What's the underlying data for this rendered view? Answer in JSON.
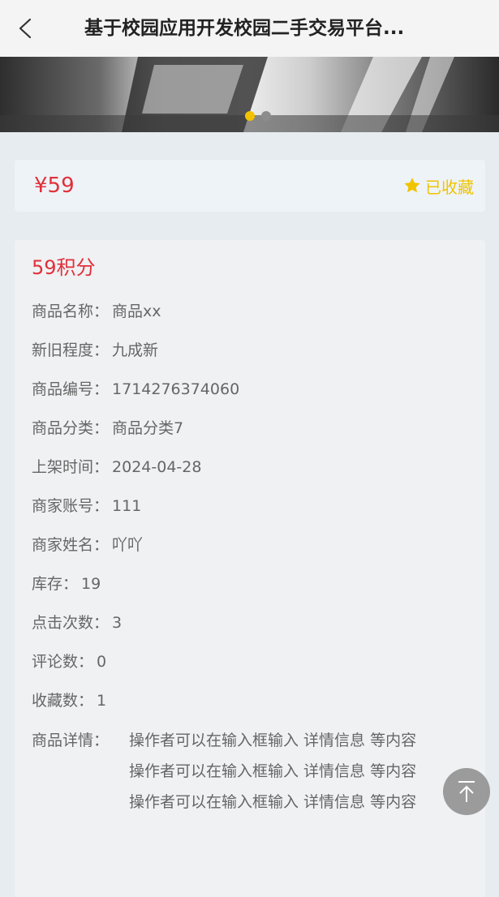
{
  "header": {
    "title": "基于校园应用开发校园二手交易平台..."
  },
  "banner": {
    "slide_count": 2,
    "active_index": 0
  },
  "price_card": {
    "price": "¥59",
    "favorite_label": "已收藏",
    "favorite_icon": "star-icon",
    "favorite_color": "#f0c400"
  },
  "detail": {
    "points": "59积分",
    "rows": [
      {
        "label": "商品名称：",
        "value": "商品xx"
      },
      {
        "label": "新旧程度：",
        "value": "九成新"
      },
      {
        "label": "商品编号：",
        "value": "1714276374060"
      },
      {
        "label": "商品分类：",
        "value": "商品分类7"
      },
      {
        "label": "上架时间：",
        "value": "2024-04-28"
      },
      {
        "label": "商家账号：",
        "value": "111"
      },
      {
        "label": "商家姓名：",
        "value": "吖吖"
      },
      {
        "label": "库存：",
        "value": "19"
      },
      {
        "label": "点击次数：",
        "value": "3"
      },
      {
        "label": "评论数：",
        "value": "0"
      },
      {
        "label": "收藏数：",
        "value": "1"
      }
    ],
    "description_label": "商品详情：",
    "description_lines": [
      "操作者可以在输入框输入 详情信息 等内容",
      "操作者可以在输入框输入 详情信息 等内容",
      "操作者可以在输入框输入 详情信息 等内容"
    ]
  },
  "colors": {
    "price_red": "#e0303a",
    "accent_yellow": "#f0c400",
    "background": "#e6ecf0"
  }
}
